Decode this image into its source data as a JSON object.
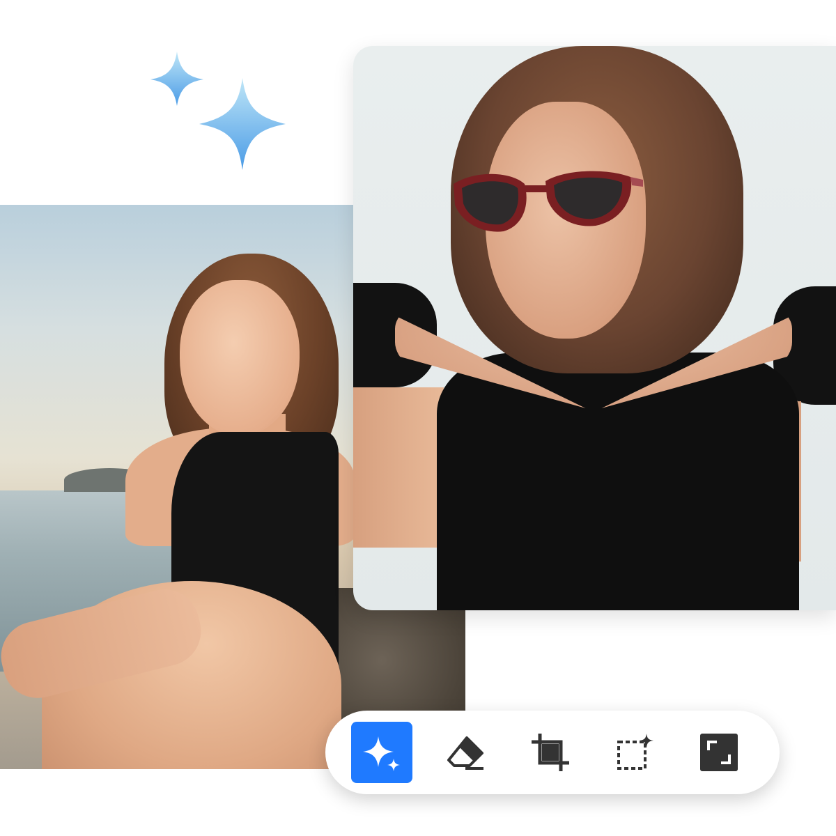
{
  "toolbar": {
    "tools": [
      {
        "name": "ai-enhance",
        "icon": "sparkle-icon",
        "active": true
      },
      {
        "name": "eraser",
        "icon": "eraser-icon",
        "active": false
      },
      {
        "name": "crop",
        "icon": "crop-icon",
        "active": false
      },
      {
        "name": "ai-select",
        "icon": "select-sparkle-icon",
        "active": false
      },
      {
        "name": "expand",
        "icon": "expand-icon",
        "active": false
      }
    ]
  },
  "colors": {
    "accent": "#1f7aff",
    "icon": "#333333",
    "sparkle_light": "#a9d8f5",
    "sparkle_dark": "#4a9be6"
  },
  "images": {
    "left_photo": "woman-seated-by-sea-photo",
    "right_photo": "woman-with-sunglasses-photo"
  }
}
